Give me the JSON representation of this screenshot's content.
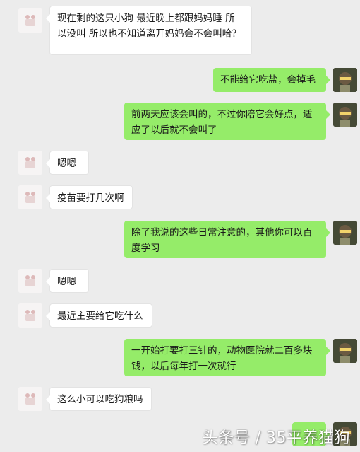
{
  "colors": {
    "background": "#ececec",
    "incoming_bubble": "#ffffff",
    "outgoing_bubble": "#95ec69"
  },
  "messages": [
    {
      "side": "left",
      "text": "现在剩的这只小狗 最近晚上都跟妈妈睡   所以没叫    所以也不知道离开妈妈会不会叫哈？"
    },
    {
      "side": "right",
      "text": "不能给它吃盐，会掉毛"
    },
    {
      "side": "right",
      "text": "前两天应该会叫的，不过你陪它会好点，适应了以后就不会叫了"
    },
    {
      "side": "left",
      "text": "嗯嗯"
    },
    {
      "side": "left",
      "text": "疫苗要打几次啊"
    },
    {
      "side": "right",
      "text": "除了我说的这些日常注意的，其他你可以百度学习"
    },
    {
      "side": "left",
      "text": "嗯嗯"
    },
    {
      "side": "left",
      "text": "最近主要给它吃什么"
    },
    {
      "side": "right",
      "text": "一开始打要打三针的，动物医院就二百多块钱，以后每年打一次就行"
    },
    {
      "side": "left",
      "text": "这么小可以吃狗粮吗"
    },
    {
      "side": "right",
      "text": ""
    }
  ],
  "watermark": "头条号 / 35平养猫狗"
}
